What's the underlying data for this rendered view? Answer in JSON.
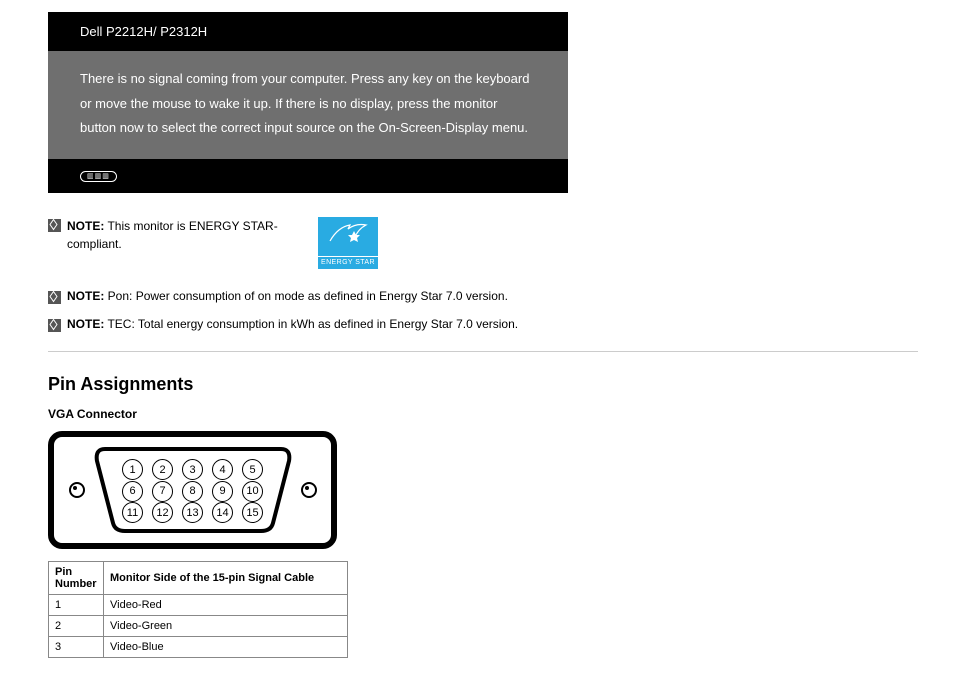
{
  "osd": {
    "header": "Dell P2212H/ P2312H",
    "body": "There is no signal coming from your computer. Press any key on the keyboard or move the mouse to wake it up. If there is no display, press the monitor button now to select the correct input source on the On-Screen-Display menu.",
    "footer_badge": "▥▥▥"
  },
  "notes": {
    "energystar_prefix": "NOTE:",
    "energystar_text": " This monitor is ENERGY STAR-compliant.",
    "energystar_badge_label": "ENERGY STAR",
    "n1_prefix": "NOTE:",
    "n1_text": " Pon: Power consumption of on mode as defined in Energy Star 7.0 version.",
    "n2_prefix": "NOTE:",
    "n2_text": " TEC: Total energy consumption in kWh as defined in Energy Star 7.0 version."
  },
  "section": {
    "title": "Pin Assignments",
    "sub_vga": "VGA Connector"
  },
  "vga_pins": {
    "row1": [
      "1",
      "2",
      "3",
      "4",
      "5"
    ],
    "row2": [
      "6",
      "7",
      "8",
      "9",
      "10"
    ],
    "row3": [
      "11",
      "12",
      "13",
      "14",
      "15"
    ]
  },
  "pin_table": {
    "headers": [
      "Pin Number",
      "Monitor Side of the 15-pin Signal Cable"
    ],
    "rows": [
      [
        "1",
        "Video-Red"
      ],
      [
        "2",
        "Video-Green"
      ],
      [
        "3",
        "Video-Blue"
      ]
    ]
  }
}
